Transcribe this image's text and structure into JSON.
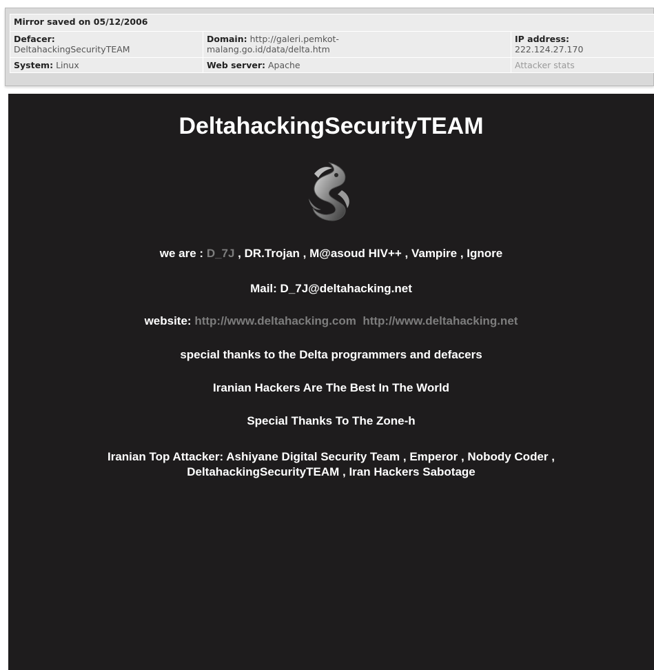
{
  "mirror": {
    "saved": "Mirror saved on 05/12/2006",
    "defacer_label": "Defacer:",
    "defacer_value": "DeltahackingSecurityTEAM",
    "domain_label": "Domain:",
    "domain_value_1": "http://galeri.pemkot-",
    "domain_value_2": "malang.go.id/data/delta.htm",
    "ip_label": "IP address:",
    "ip_value": "222.124.27.170",
    "system_label": "System:",
    "system_value": "Linux",
    "webserver_label": "Web server:",
    "webserver_value": "Apache",
    "attacker_stats": "Attacker stats"
  },
  "deface": {
    "title": "DeltahackingSecurityTEAM",
    "logo_icon": "dragon-emblem-icon",
    "we_are_label": "we are : ",
    "we_are_link": "D_7J",
    "we_are_rest": " , DR.Trojan , M@asoud HIV++ , Vampire , Ignore",
    "mail": "Mail: D_7J@deltahacking.net",
    "website_label": "website: ",
    "website_link_1": "http://www.deltahacking.com",
    "website_link_2": "http://www.deltahacking.net",
    "thanks_programmers": "special thanks to the Delta programmers and defacers",
    "iranian_best": "Iranian Hackers Are The Best In The World",
    "thanks_zoneh": "Special Thanks To The Zone-h",
    "top_attacker_1": "Iranian Top Attacker: Ashiyane Digital Security Team , Emperor , Nobody Coder ,",
    "top_attacker_2": "DeltahackingSecurityTEAM , Iran Hackers Sabotage"
  },
  "colors": {
    "page_bg": "#1e1c1d",
    "link_grey": "#7d7d7d",
    "header_bg": "#ececec"
  }
}
